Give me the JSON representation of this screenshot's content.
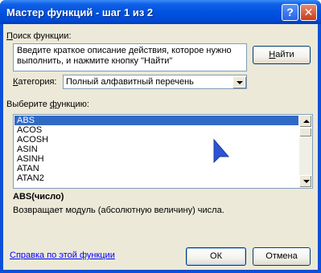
{
  "window": {
    "title": "Мастер функций - шаг 1 из 2",
    "help_button": "?",
    "close_button": "✕"
  },
  "search": {
    "label": "Поиск функции:",
    "label_hotkey": "П",
    "label_rest": "оиск функции:",
    "value": "Введите краткое описание действия, которое нужно выполнить, и нажмите кнопку \"Найти\"",
    "find_button": "Найти",
    "find_hotkey": "Н",
    "find_rest": "айти"
  },
  "category": {
    "label": "Категория:",
    "label_hotkey": "К",
    "label_rest": "атегория:",
    "selected": "Полный алфавитный перечень"
  },
  "functions": {
    "label": "Выберите функцию:",
    "label_prefix": "Выберите ",
    "label_hotkey": "ф",
    "label_rest": "ункцию:",
    "items": [
      "ABS",
      "ACOS",
      "ACOSH",
      "ASIN",
      "ASINH",
      "ATAN",
      "ATAN2"
    ],
    "selected_index": 0
  },
  "details": {
    "signature": "ABS(число)",
    "description": "Возвращает модуль (абсолютную величину) числа."
  },
  "footer": {
    "help_link": "Справка по этой функции",
    "ok_button": "ОК",
    "cancel_button": "Отмена"
  },
  "colors": {
    "titlebar": "#0053e0",
    "selection": "#316ac5",
    "link": "#0000ff",
    "pointer": "#2b55d6"
  },
  "icons": {
    "pointer": "mouse-pointer-icon"
  }
}
